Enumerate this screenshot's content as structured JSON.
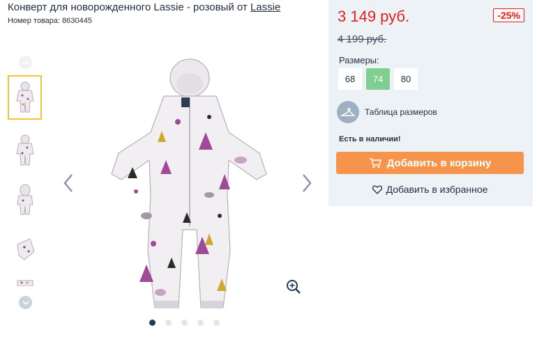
{
  "product": {
    "title_prefix": "Конверт для новорожденного Lassie - розовый от ",
    "brand_link": "Lassie",
    "sku": "Номер товара: 8630445"
  },
  "gallery": {
    "thumbnails": [
      {
        "label": "jumpsuit-front"
      },
      {
        "label": "jumpsuit-back"
      },
      {
        "label": "jumpsuit-hood"
      },
      {
        "label": "jumpsuit-folded"
      },
      {
        "label": "jumpsuit-detail"
      }
    ],
    "active_thumbnail": 0,
    "dot_count": 5,
    "active_dot": 0
  },
  "purchase": {
    "price": "3 149 руб.",
    "discount": "-25%",
    "old_price": "4 199 руб.",
    "sizes_label": "Размеры:",
    "sizes": [
      "68",
      "74",
      "80"
    ],
    "selected_size": "74",
    "size_table_label": "Таблица размеров",
    "stock": "Есть в наличии!",
    "add_to_cart": "Добавить в корзину",
    "add_to_favorites": "Добавить в избранное"
  },
  "colors": {
    "price_red": "#e02020",
    "cart_orange": "#f5944a",
    "size_selected_green": "#7fcf90",
    "panel_bg": "#edf2f6",
    "active_thumb_border": "#f4c430"
  },
  "icons": {
    "thumb_up": "chevron-up-icon",
    "thumb_down": "chevron-down-icon",
    "prev": "chevron-left-icon",
    "next": "chevron-right-icon",
    "zoom": "zoom-in-icon",
    "size_table": "hanger-icon",
    "cart": "cart-icon",
    "favorite": "heart-icon"
  }
}
